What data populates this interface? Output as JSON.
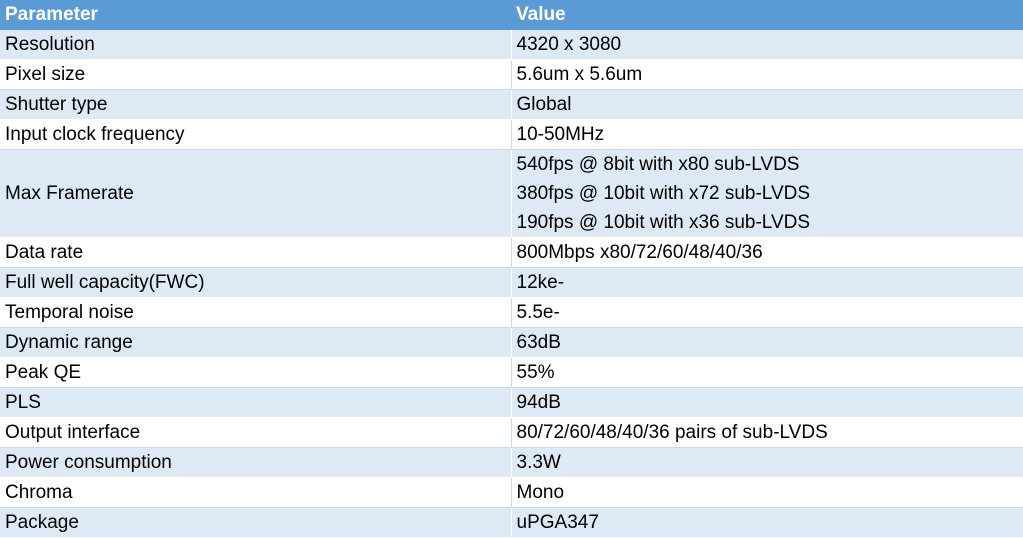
{
  "header": {
    "col1": "Parameter",
    "col2": "Value"
  },
  "rows": [
    {
      "param": "Resolution",
      "value": [
        "4320 x 3080"
      ]
    },
    {
      "param": "Pixel size",
      "value": [
        "5.6um x 5.6um"
      ]
    },
    {
      "param": "Shutter type",
      "value": [
        "Global"
      ]
    },
    {
      "param": "Input clock frequency",
      "value": [
        "10-50MHz"
      ]
    },
    {
      "param": "Max Framerate",
      "value": [
        "540fps @ 8bit with x80 sub-LVDS",
        "380fps @ 10bit with x72 sub-LVDS",
        "190fps @ 10bit with x36 sub-LVDS"
      ]
    },
    {
      "param": "Data rate",
      "value": [
        "800Mbps x80/72/60/48/40/36"
      ]
    },
    {
      "param": "Full well capacity(FWC)",
      "value": [
        "12ke-"
      ]
    },
    {
      "param": "Temporal noise",
      "value": [
        "5.5e-"
      ]
    },
    {
      "param": "Dynamic range",
      "value": [
        "63dB"
      ]
    },
    {
      "param": "Peak QE",
      "value": [
        "55%"
      ]
    },
    {
      "param": "PLS",
      "value": [
        "94dB"
      ]
    },
    {
      "param": "Output interface",
      "value": [
        "80/72/60/48/40/36 pairs of sub-LVDS"
      ]
    },
    {
      "param": "Power consumption",
      "value": [
        "3.3W"
      ]
    },
    {
      "param": "Chroma",
      "value": [
        "Mono"
      ]
    },
    {
      "param": "Package",
      "value": [
        "uPGA347"
      ]
    }
  ],
  "colors": {
    "header": "#5b9bd5",
    "band": "#dde9f4"
  }
}
